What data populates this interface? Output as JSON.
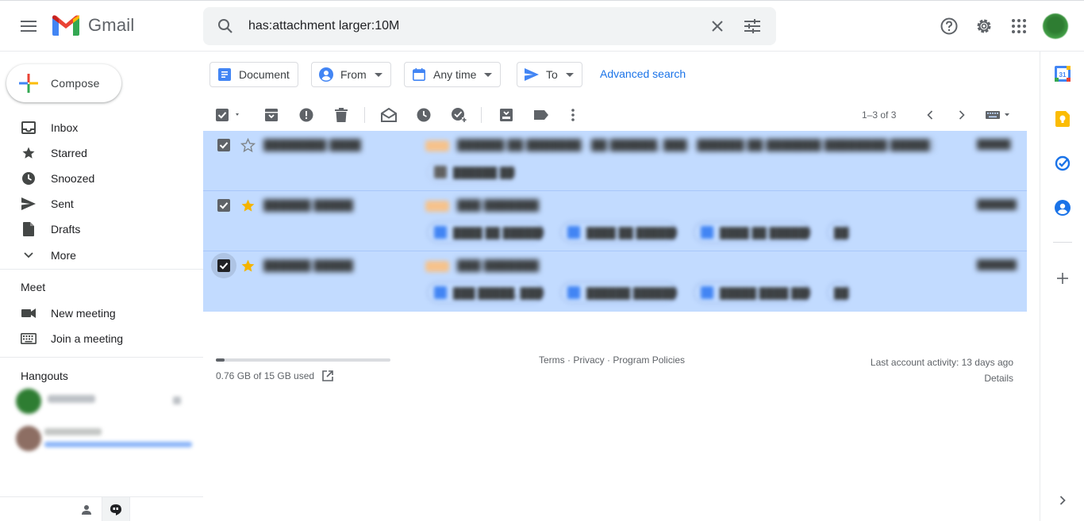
{
  "app": {
    "name": "Gmail"
  },
  "search": {
    "query": "has:attachment larger:10M"
  },
  "sidebar": {
    "compose_label": "Compose",
    "items": [
      {
        "label": "Inbox",
        "icon": "inbox-icon"
      },
      {
        "label": "Starred",
        "icon": "star-icon"
      },
      {
        "label": "Snoozed",
        "icon": "clock-icon"
      },
      {
        "label": "Sent",
        "icon": "send-icon"
      },
      {
        "label": "Drafts",
        "icon": "draft-icon"
      },
      {
        "label": "More",
        "icon": "chevron-down-icon"
      }
    ],
    "meet": {
      "title": "Meet",
      "items": [
        {
          "label": "New meeting",
          "icon": "video-camera-icon"
        },
        {
          "label": "Join a meeting",
          "icon": "keyboard-icon"
        }
      ]
    },
    "hangouts": {
      "title": "Hangouts"
    }
  },
  "filters": {
    "chips": [
      {
        "label": "Document",
        "icon": "document-icon"
      },
      {
        "label": "From",
        "icon": "person-icon"
      },
      {
        "label": "Any time",
        "icon": "calendar-icon"
      },
      {
        "label": "To",
        "icon": "send-icon"
      }
    ],
    "advanced_label": "Advanced search"
  },
  "toolbar": {
    "pager": "1–3 of 3"
  },
  "footer": {
    "storage_text": "0.76 GB of 15 GB used",
    "storage_used_fraction": 0.05,
    "terms": "Terms",
    "privacy": "Privacy",
    "program_policies": "Program Policies",
    "sep": " · ",
    "activity": "Last account activity: 13 days ago",
    "details": "Details"
  },
  "colors": {
    "selected_row": "#c2dbff",
    "accent": "#1a73e8",
    "star": "#f4b400"
  }
}
